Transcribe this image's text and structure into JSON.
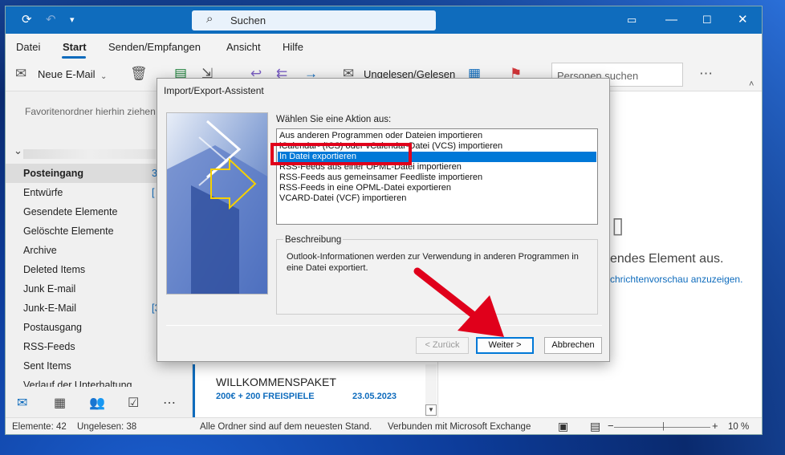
{
  "titlebar": {
    "search_label": "Suchen"
  },
  "menu": {
    "items": [
      "Datei",
      "Start",
      "Senden/Empfangen",
      "Ansicht",
      "Hilfe"
    ]
  },
  "ribbon": {
    "new_mail": "Neue E-Mail",
    "read_unread": "Ungelesen/Gelesen",
    "search_people_placeholder": "Personen suchen"
  },
  "sidebar": {
    "favorites_hint": "Favoritenordner hierhin ziehen",
    "folders": [
      {
        "label": "Posteingang",
        "count": "3"
      },
      {
        "label": "Entwürfe",
        "count": "["
      },
      {
        "label": "Gesendete Elemente",
        "count": ""
      },
      {
        "label": "Gelöschte Elemente",
        "count": ""
      },
      {
        "label": "Archive",
        "count": ""
      },
      {
        "label": "Deleted Items",
        "count": ""
      },
      {
        "label": "Junk E-mail",
        "count": ""
      },
      {
        "label": "Junk-E-Mail",
        "count": "[3"
      },
      {
        "label": "Postausgang",
        "count": ""
      },
      {
        "label": "RSS-Feeds",
        "count": ""
      },
      {
        "label": "Sent Items",
        "count": ""
      },
      {
        "label": "Verlauf der Unterhaltung",
        "count": ""
      }
    ]
  },
  "message": {
    "title": "WILLKOMMENSPAKET",
    "subtitle": "200€ + 200 FREISPIELE",
    "date": "23.05.2023"
  },
  "reading": {
    "line1": "endes Element aus.",
    "line2": "chrichtenvorschau anzuzeigen."
  },
  "status": {
    "items": "Elemente: 42",
    "unread": "Ungelesen: 38",
    "sync": "Alle Ordner sind auf dem neuesten Stand.",
    "connection": "Verbunden mit Microsoft Exchange",
    "zoom": "10 %"
  },
  "dialog": {
    "title": "Import/Export-Assistent",
    "prompt": "Wählen Sie eine Aktion aus:",
    "options": [
      "Aus anderen Programmen oder Dateien importieren",
      "iCalendar- (ICS) oder vCalendar-Datei (VCS) importieren",
      "In Datei exportieren",
      "RSS-Feeds aus einer OPML-Datei importieren",
      "RSS-Feeds aus gemeinsamer Feedliste importieren",
      "RSS-Feeds in eine OPML-Datei exportieren",
      "VCARD-Datei (VCF) importieren"
    ],
    "selected_index": 2,
    "description_label": "Beschreibung",
    "description": "Outlook-Informationen werden zur Verwendung in anderen Programmen in eine Datei exportiert.",
    "back": "< Zurück",
    "next": "Weiter >",
    "cancel": "Abbrechen"
  },
  "colors": {
    "accent": "#0f6cbd",
    "selection": "#0078d7",
    "highlight": "#e0001b"
  }
}
